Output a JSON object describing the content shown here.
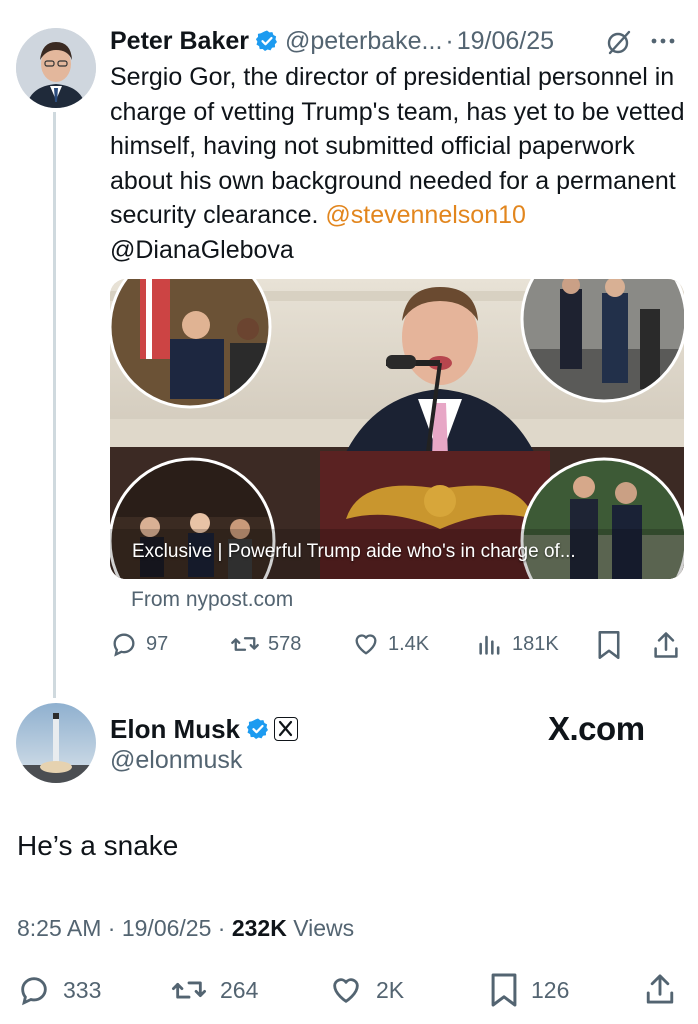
{
  "quoted_post": {
    "author_name": "Peter Baker",
    "handle": "@peterbake...",
    "separator": "·",
    "date": "19/06/25",
    "body_text": "Sergio Gor, the director of presidential personnel in charge of vetting Trump's team, has yet to be vetted himself, having not submitted official paperwork about his own background needed for a permanent security clearance.",
    "mention_1": "@stevennelson10",
    "mention_2": "@DianaGlebova",
    "link_card": {
      "caption": "Exclusive | Powerful Trump aide who's in charge of...",
      "source": "From nypost.com"
    },
    "stats": {
      "replies": "97",
      "reposts": "578",
      "likes": "1.4K",
      "views": "181K"
    }
  },
  "main_post": {
    "author_name": "Elon Musk",
    "handle": "@elonmusk",
    "brand_text": "X.com",
    "body_text": "He’s a snake",
    "time": "8:25 AM",
    "separator": "·",
    "date": "19/06/25",
    "separator_2": "·",
    "views_count": "232K",
    "views_label": "Views",
    "stats": {
      "replies": "333",
      "reposts": "264",
      "likes": "2K",
      "bookmarks": "126"
    }
  },
  "colors": {
    "verified_blue": "#1d9bf0",
    "mention_orange": "#e2861e",
    "secondary_text": "#536471",
    "thread_line": "#cfd9de"
  }
}
